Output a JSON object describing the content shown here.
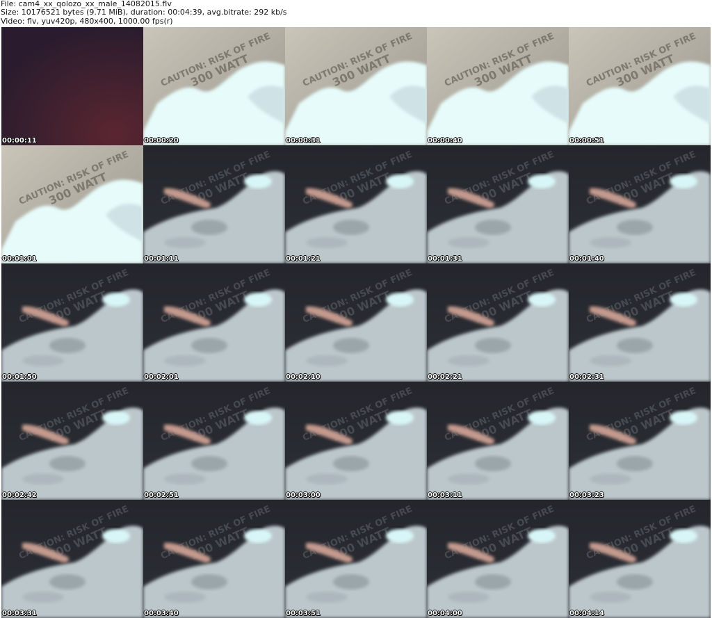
{
  "header": {
    "file_line": "File: cam4_xx_qolozo_xx_male_14082015.flv",
    "size_line": "Size: 10176521 bytes (9.71 MiB), duration: 00:04:39, avg.bitrate: 292 kb/s",
    "video_line": "Video: flv, yuv420p, 480x400, 1000.00 fps(r)"
  },
  "frame_label_text": {
    "line1": "CAUTION: RISK OF FIRE",
    "line2": "300 WATT"
  },
  "colors": {
    "dark_frame": "#2a1c2e",
    "bright_bg": "#9a968c",
    "bright_glow": "#e6fbfa",
    "dim_bg": "#2c2f35",
    "dim_cloth": "#bcc7cc",
    "skin": "#c49a8e",
    "highlight": "#d8f6f7"
  },
  "thumbnails": [
    {
      "time": "00:00:11",
      "scene": "dark"
    },
    {
      "time": "00:00:20",
      "scene": "bright"
    },
    {
      "time": "00:00:31",
      "scene": "bright"
    },
    {
      "time": "00:00:40",
      "scene": "bright"
    },
    {
      "time": "00:00:51",
      "scene": "bright"
    },
    {
      "time": "00:01:01",
      "scene": "bright"
    },
    {
      "time": "00:01:11",
      "scene": "dim"
    },
    {
      "time": "00:01:21",
      "scene": "dim"
    },
    {
      "time": "00:01:31",
      "scene": "dim"
    },
    {
      "time": "00:01:40",
      "scene": "dim"
    },
    {
      "time": "00:01:50",
      "scene": "dim"
    },
    {
      "time": "00:02:01",
      "scene": "dim"
    },
    {
      "time": "00:02:10",
      "scene": "dim"
    },
    {
      "time": "00:02:21",
      "scene": "dim"
    },
    {
      "time": "00:02:31",
      "scene": "dim"
    },
    {
      "time": "00:02:42",
      "scene": "dim"
    },
    {
      "time": "00:02:51",
      "scene": "dim"
    },
    {
      "time": "00:03:00",
      "scene": "dim"
    },
    {
      "time": "00:03:11",
      "scene": "dim"
    },
    {
      "time": "00:03:23",
      "scene": "dim"
    },
    {
      "time": "00:03:31",
      "scene": "dim"
    },
    {
      "time": "00:03:40",
      "scene": "dim"
    },
    {
      "time": "00:03:51",
      "scene": "dim"
    },
    {
      "time": "00:04:00",
      "scene": "dim"
    },
    {
      "time": "00:04:14",
      "scene": "dim"
    }
  ]
}
